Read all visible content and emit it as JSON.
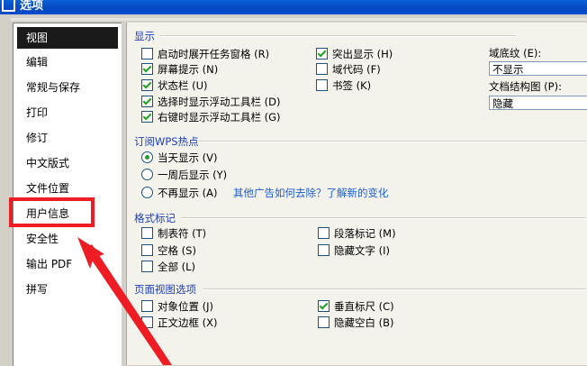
{
  "window": {
    "title": "选项"
  },
  "sidebar": {
    "items": [
      {
        "label": "视图",
        "selected": true
      },
      {
        "label": "编辑"
      },
      {
        "label": "常规与保存"
      },
      {
        "label": "打印"
      },
      {
        "label": "修订"
      },
      {
        "label": "中文版式"
      },
      {
        "label": "文件位置"
      },
      {
        "label": "用户信息"
      },
      {
        "label": "安全性"
      },
      {
        "label": "输出 PDF"
      },
      {
        "label": "拼写"
      }
    ]
  },
  "display": {
    "title": "显示",
    "options": [
      {
        "label": "启动时展开任务窗格 (R)",
        "checked": false
      },
      {
        "label": "屏幕提示 (N)",
        "checked": true
      },
      {
        "label": "状态栏 (U)",
        "checked": true
      },
      {
        "label": "选择时显示浮动工具栏 (D)",
        "checked": true
      },
      {
        "label": "右键时显示浮动工具栏 (G)",
        "checked": true
      },
      {
        "label": "突出显示 (H)",
        "checked": true
      },
      {
        "label": "域代码 (F)",
        "checked": false
      },
      {
        "label": "书签 (K)",
        "checked": false
      }
    ],
    "field_shading_label": "域底纹 (E):",
    "field_shading_value": "不显示",
    "doc_map_label": "文档结构图 (P):",
    "doc_map_value": "隐藏"
  },
  "wps_hot": {
    "title": "订阅WPS热点",
    "options": [
      {
        "label": "当天显示 (V)",
        "checked": true
      },
      {
        "label": "一周后显示 (Y)",
        "checked": false
      },
      {
        "label": "不再显示 (A)",
        "checked": false
      }
    ],
    "link": "其他广告如何去除？了解新的变化"
  },
  "format_marks": {
    "title": "格式标记",
    "options": [
      {
        "label": "制表符 (T)",
        "checked": false
      },
      {
        "label": "空格 (S)",
        "checked": false
      },
      {
        "label": "全部 (L)",
        "checked": false
      },
      {
        "label": "段落标记 (M)",
        "checked": false
      },
      {
        "label": "隐藏文字 (I)",
        "checked": false
      }
    ]
  },
  "page_view": {
    "title": "页面视图选项",
    "options": [
      {
        "label": "对象位置 (J)",
        "checked": false
      },
      {
        "label": "正文边框 (X)",
        "checked": false
      },
      {
        "label": "垂直标尺 (C)",
        "checked": true
      },
      {
        "label": "隐藏空白 (B)",
        "checked": false
      }
    ]
  },
  "annotation_colors": {
    "highlight": "#ee1c23"
  }
}
